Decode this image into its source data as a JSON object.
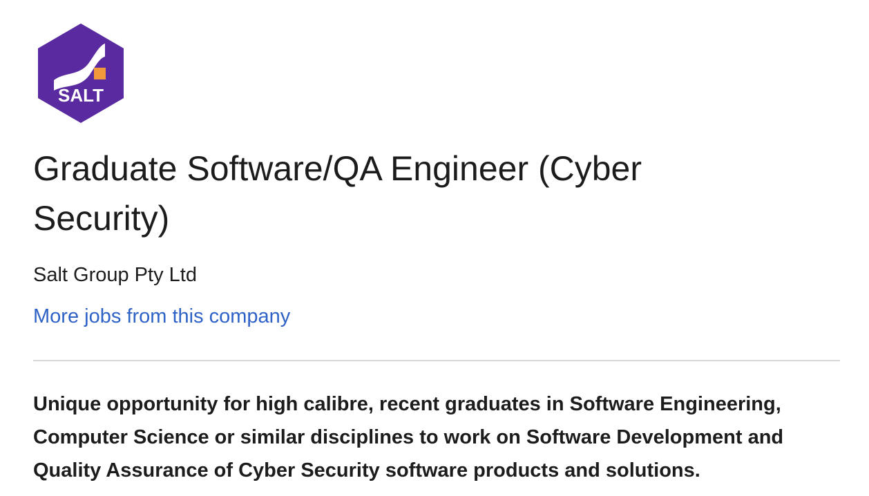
{
  "company_logo": {
    "text": "SALT",
    "icon": "salt-hexagon-logo",
    "colors": {
      "hexagon": "#5a2aa0",
      "swoosh": "#ffffff",
      "square": "#f29a3b"
    }
  },
  "job": {
    "title": "Graduate Software/QA Engineer (Cyber Security)",
    "company": "Salt Group Pty Ltd",
    "more_jobs_link": "More jobs from this company",
    "summary": "Unique opportunity for high calibre, recent graduates in Software Engineering, Computer Science or similar disciplines to work on Software Development and Quality Assurance of Cyber Security software products and solutions."
  },
  "colors": {
    "link": "#2f62c6",
    "text": "#1c1c1c",
    "divider": "#d6d6d6"
  }
}
